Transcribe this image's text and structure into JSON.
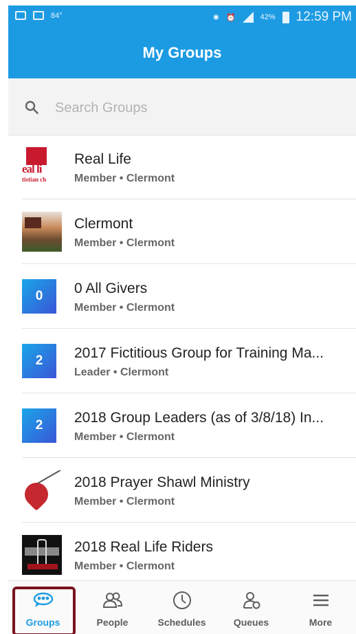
{
  "status_bar": {
    "temperature": "84°",
    "battery": "42%",
    "network": "LTE",
    "time": "12:59 PM"
  },
  "header": {
    "title": "My Groups"
  },
  "search": {
    "placeholder": "Search Groups",
    "value": ""
  },
  "groups": [
    {
      "name": "Real Life",
      "role": "Member",
      "location": "Clermont",
      "subtitle": "Member • Clermont",
      "thumb": "image-real-life-logo"
    },
    {
      "name": "Clermont",
      "role": "Member",
      "location": "Clermont",
      "subtitle": "Member • Clermont",
      "thumb": "image-clermont-building"
    },
    {
      "name": "0 All Givers",
      "role": "Member",
      "location": "Clermont",
      "subtitle": "Member • Clermont",
      "badge": "0"
    },
    {
      "name": "2017 Fictitious Group for Training Ma...",
      "role": "Leader",
      "location": "Clermont",
      "subtitle": "Leader • Clermont",
      "badge": "2"
    },
    {
      "name": "2018 Group Leaders (as of 3/8/18) In...",
      "role": "Member",
      "location": "Clermont",
      "subtitle": "Member • Clermont",
      "badge": "2"
    },
    {
      "name": "2018 Prayer Shawl Ministry",
      "role": "Member",
      "location": "Clermont",
      "subtitle": "Member • Clermont",
      "thumb": "image-prayer-shawl"
    },
    {
      "name": "2018 Real Life Riders",
      "role": "Member",
      "location": "Clermont",
      "subtitle": "Member • Clermont",
      "thumb": "image-riders-logo"
    }
  ],
  "thumb_text": {
    "real_life_logo_line1": "eal li",
    "real_life_logo_line2": "tistian ch"
  },
  "bottom_nav": [
    {
      "label": "Groups",
      "icon": "groups-icon",
      "active": true
    },
    {
      "label": "People",
      "icon": "people-icon",
      "active": false
    },
    {
      "label": "Schedules",
      "icon": "clock-icon",
      "active": false
    },
    {
      "label": "Queues",
      "icon": "queue-person-icon",
      "active": false
    },
    {
      "label": "More",
      "icon": "hamburger-icon",
      "active": false
    }
  ],
  "colors": {
    "primary": "#1c9be3",
    "badge_gradient_start": "#1aa6e7",
    "badge_gradient_end": "#3a55d8",
    "highlight": "#7a1320"
  }
}
